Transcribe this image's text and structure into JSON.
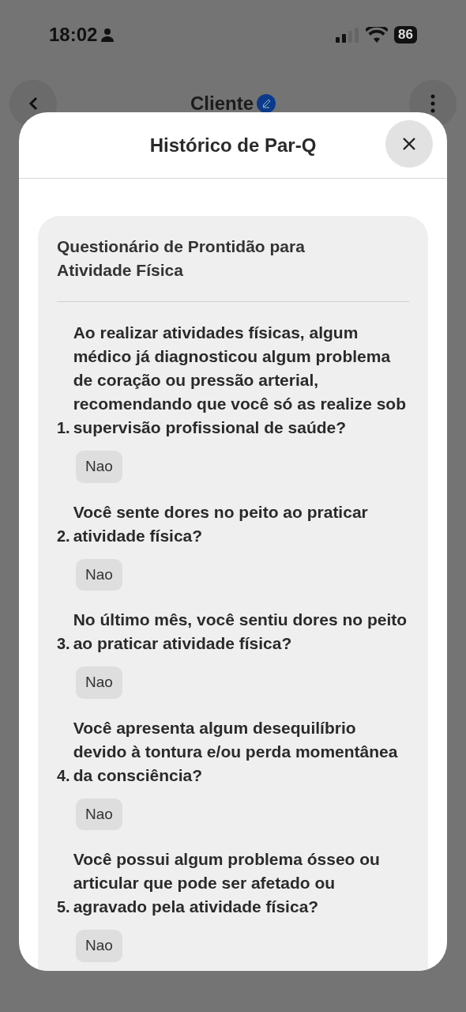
{
  "status_bar": {
    "time": "18:02",
    "battery": "86"
  },
  "nav": {
    "title": "Cliente"
  },
  "modal": {
    "title": "Histórico de Par-Q",
    "card": {
      "title": "Questionário de Prontidão para Atividade Física",
      "questions": [
        {
          "number": "1.",
          "text": "Ao realizar atividades físicas, algum médico já diagnosticou algum problema de coração ou pressão arterial, recomendando que você só as realize sob supervisão profissional de saúde?",
          "answer": "Nao"
        },
        {
          "number": "2.",
          "text": "Você sente dores no peito ao praticar atividade física?",
          "answer": "Nao"
        },
        {
          "number": "3.",
          "text": "No último mês, você sentiu dores no peito ao praticar atividade física?",
          "answer": "Nao"
        },
        {
          "number": "4.",
          "text": "Você apresenta algum desequilíbrio devido à tontura e/ou perda momentânea da consciência?",
          "answer": "Nao"
        },
        {
          "number": "5.",
          "text": "Você possui algum problema ósseo ou articular que pode ser afetado ou agravado pela atividade física?",
          "answer": "Nao"
        }
      ]
    }
  }
}
